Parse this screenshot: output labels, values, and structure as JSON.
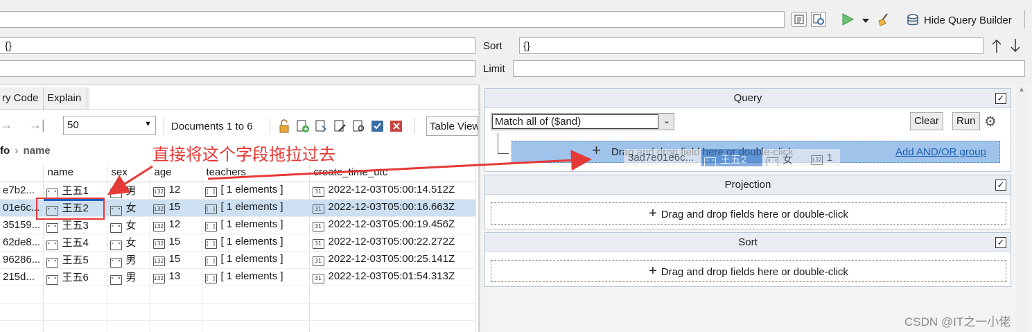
{
  "toolbar": {
    "hide_query_builder": "Hide Query Builder"
  },
  "query_bar": {
    "filter_value": "{}",
    "sort_label": "Sort",
    "sort_value": "{}",
    "limit_label": "Limit",
    "limit_value": ""
  },
  "left_tabs": [
    "ry Code",
    "Explain"
  ],
  "results_toolbar": {
    "page_size": "50",
    "documents_label": "Documents 1 to 6",
    "view_mode": "Table View"
  },
  "breadcrumb": {
    "parent": "fo",
    "current": "name"
  },
  "annotation_text": "直接将这个字段拖拉过去",
  "table": {
    "columns": [
      "",
      "name",
      "sex",
      "age",
      "teachers",
      "create_time_utc"
    ],
    "rows": [
      {
        "id": "e7b2...",
        "name": "王五1",
        "sex": "男",
        "age": "12",
        "teachers": "[ 1 elements ]",
        "created": "2022-12-03T05:00:14.512Z"
      },
      {
        "id": "01e6c...",
        "name": "王五2",
        "sex": "女",
        "age": "15",
        "teachers": "[ 1 elements ]",
        "created": "2022-12-03T05:00:16.663Z"
      },
      {
        "id": "35159...",
        "name": "王五3",
        "sex": "女",
        "age": "12",
        "teachers": "[ 1 elements ]",
        "created": "2022-12-03T05:00:19.456Z"
      },
      {
        "id": "62de8...",
        "name": "王五4",
        "sex": "女",
        "age": "15",
        "teachers": "[ 1 elements ]",
        "created": "2022-12-03T05:00:22.272Z"
      },
      {
        "id": "96286...",
        "name": "王五5",
        "sex": "男",
        "age": "15",
        "teachers": "[ 1 elements ]",
        "created": "2022-12-03T05:00:25.141Z"
      },
      {
        "id": "215d...",
        "name": "王五6",
        "sex": "男",
        "age": "13",
        "teachers": "[ 1 elements ]",
        "created": "2022-12-03T05:01:54.313Z"
      }
    ]
  },
  "builder": {
    "query": {
      "title": "Query",
      "match_option": "Match all of ($and)",
      "clear": "Clear",
      "run": "Run",
      "drop_hint": "Drag and drop field here or double-click",
      "add_group": "Add AND/OR group",
      "drag_ghost": {
        "id": "3ad7e01e6c...",
        "name": "王五2",
        "sex": "女",
        "age": "1"
      }
    },
    "projection": {
      "title": "Projection",
      "drop_hint": "Drag and drop fields here or double-click"
    },
    "sort": {
      "title": "Sort",
      "drop_hint": "Drag and drop fields here or double-click"
    }
  },
  "watermark": "CSDN @IT之一小佬",
  "colors": {
    "annotation_red": "#e53935",
    "selected_row": "#cce0f2",
    "drop_highlight": "#9fc3ea",
    "link_blue": "#1a5fb4",
    "run_green": "#4caf50"
  }
}
